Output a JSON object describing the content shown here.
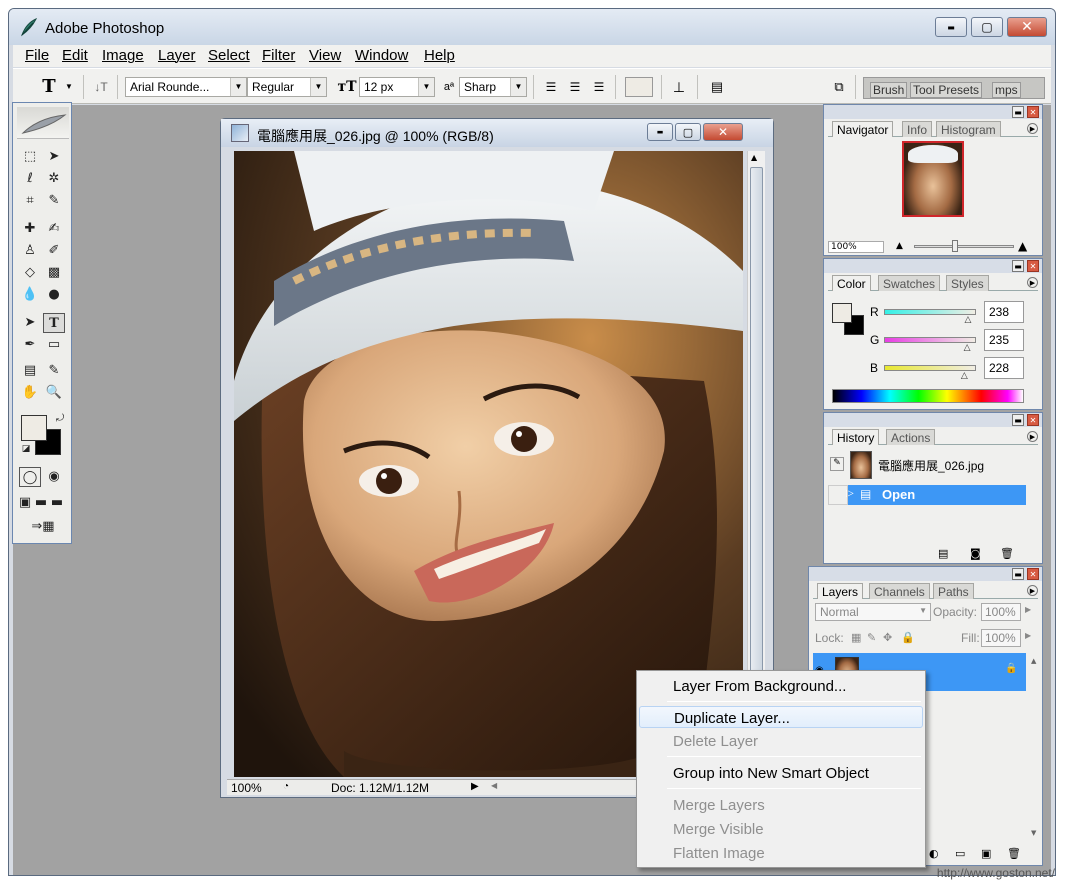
{
  "app": {
    "title": "Adobe Photoshop",
    "minimize": "▬",
    "maximize": "▢",
    "close": "✕"
  },
  "menubar": {
    "items": [
      {
        "label": "File"
      },
      {
        "label": "Edit"
      },
      {
        "label": "Image"
      },
      {
        "label": "Layer"
      },
      {
        "label": "Select"
      },
      {
        "label": "Filter"
      },
      {
        "label": "View"
      },
      {
        "label": "Window"
      },
      {
        "label": "Help"
      }
    ]
  },
  "options_bar": {
    "tool_glyph": "T",
    "font_family": "Arial Rounde...",
    "font_style": "Regular",
    "font_size": "12 px",
    "aa_label": "a",
    "anti_alias": "Sharp",
    "palette_well_tabs": [
      "Brush",
      "Tool Presets",
      "mps"
    ]
  },
  "document": {
    "title": "電腦應用展_026.jpg @ 100% (RGB/8)",
    "zoom": "100%",
    "doc_size": "Doc: 1.12M/1.12M"
  },
  "navigator_panel": {
    "tabs": [
      "Navigator",
      "Info",
      "Histogram"
    ],
    "zoom": "100%"
  },
  "color_panel": {
    "tabs": [
      "Color",
      "Swatches",
      "Styles"
    ],
    "channels": [
      {
        "label": "R",
        "value": "238"
      },
      {
        "label": "G",
        "value": "235"
      },
      {
        "label": "B",
        "value": "228"
      }
    ],
    "slider_positions": {
      "R": 0.93,
      "G": 0.92,
      "B": 0.89
    }
  },
  "history_panel": {
    "tabs": [
      "History",
      "Actions"
    ],
    "snapshot_label": "電腦應用展_026.jpg",
    "states": [
      {
        "label": "Open"
      }
    ]
  },
  "layers_panel": {
    "tabs": [
      "Layers",
      "Channels",
      "Paths"
    ],
    "blend_mode": "Normal",
    "opacity_label": "Opacity:",
    "opacity": "100%",
    "lock_label": "Lock:",
    "fill_label": "Fill:",
    "fill": "100%"
  },
  "context_menu": {
    "items": [
      {
        "label": "Layer From Background...",
        "disabled": false
      },
      {
        "label": "Duplicate Layer...",
        "disabled": false,
        "hover": true
      },
      {
        "label": "Delete Layer",
        "disabled": true
      },
      {
        "label": "Group into New Smart Object",
        "disabled": false
      },
      {
        "label": "Merge Layers",
        "disabled": true
      },
      {
        "label": "Merge Visible",
        "disabled": true
      },
      {
        "label": "Flatten Image",
        "disabled": true
      }
    ]
  },
  "watermark": "http://www.goston.net/",
  "colors": {
    "selection_blue": "#3d97f5",
    "foreground_swatch": "#eeebe4",
    "background_swatch": "#000000"
  }
}
